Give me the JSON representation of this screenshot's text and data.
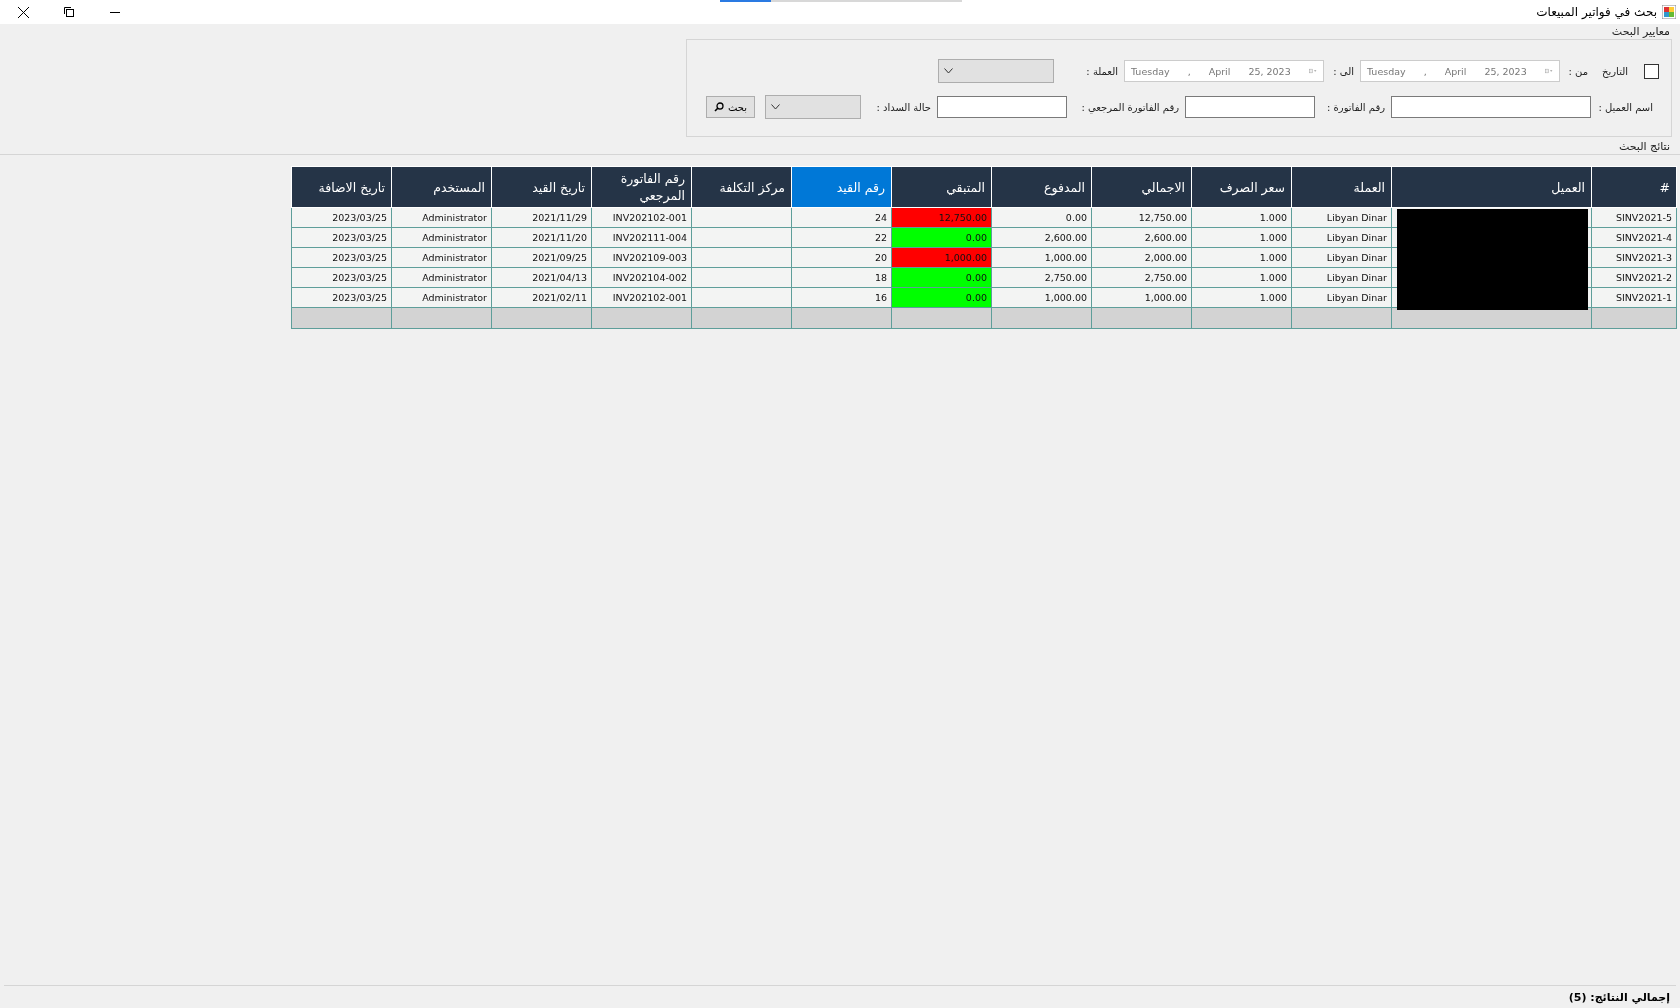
{
  "window": {
    "title": "بحث في فواتير المبيعات",
    "controls": [
      {
        "kind": "close"
      },
      {
        "kind": "restore"
      },
      {
        "kind": "minimize"
      }
    ]
  },
  "progress": {
    "level": 0.21
  },
  "criteria": {
    "legend": "معايير البحث",
    "date_filter": {
      "label": "التاريخ",
      "checked": false
    },
    "from": {
      "label": "من :",
      "weekday": "Tuesday",
      "sep": ",",
      "month": "April",
      "day": "25, 2023",
      "disabled": true
    },
    "to": {
      "label": "الى :",
      "weekday": "Tuesday",
      "sep": ",",
      "month": "April",
      "day": "25, 2023",
      "disabled": true
    },
    "currency": {
      "label": "العملة :"
    },
    "customer_name": {
      "label": "اسم العميل :"
    },
    "invoice_no": {
      "label": "رقم الفاتورة :"
    },
    "ref_invoice_no": {
      "label": "رقم الفاتورة المرجعي :"
    },
    "payment_status": {
      "label": "حالة السداد :"
    },
    "search_button": "بحث"
  },
  "results": {
    "legend": "نتائج البحث",
    "customer_redacted": true,
    "columns": [
      {
        "label": "#",
        "selected": false
      },
      {
        "label": "العميل",
        "selected": false
      },
      {
        "label": "العملة",
        "selected": false
      },
      {
        "label": "سعر الصرف",
        "selected": false
      },
      {
        "label": "الاجمالي",
        "selected": false
      },
      {
        "label": "المدفوع",
        "selected": false
      },
      {
        "label": "المتبقي",
        "selected": false
      },
      {
        "label": "رقم القيد",
        "selected": true
      },
      {
        "label": "مركز التكلفة",
        "selected": false
      },
      {
        "label": "رقم الفاتورة المرجعي",
        "selected": false
      },
      {
        "label": "تاريخ القيد",
        "selected": false
      },
      {
        "label": "المستخدم",
        "selected": false
      },
      {
        "label": "تاريخ الاضافة",
        "selected": false
      }
    ],
    "rows": [
      {
        "number": "SINV2021-5",
        "currency": "Libyan Dinar",
        "rate": "1.000",
        "total": "12,750.00",
        "paid": "0.00",
        "remaining": "12,750.00",
        "settled": false,
        "entry": "24",
        "ref": "INV202102-001",
        "entry_date": "2021/11/29",
        "user": "Administrator",
        "added": "2023/03/25"
      },
      {
        "number": "SINV2021-4",
        "currency": "Libyan Dinar",
        "rate": "1.000",
        "total": "2,600.00",
        "paid": "2,600.00",
        "remaining": "0.00",
        "settled": true,
        "entry": "22",
        "ref": "INV202111-004",
        "entry_date": "2021/11/20",
        "user": "Administrator",
        "added": "2023/03/25"
      },
      {
        "number": "SINV2021-3",
        "currency": "Libyan Dinar",
        "rate": "1.000",
        "total": "2,000.00",
        "paid": "1,000.00",
        "remaining": "1,000.00",
        "settled": false,
        "entry": "20",
        "ref": "INV202109-003",
        "entry_date": "2021/09/25",
        "user": "Administrator",
        "added": "2023/03/25"
      },
      {
        "number": "SINV2021-2",
        "currency": "Libyan Dinar",
        "rate": "1.000",
        "total": "2,750.00",
        "paid": "2,750.00",
        "remaining": "0.00",
        "settled": true,
        "entry": "18",
        "ref": "INV202104-002",
        "entry_date": "2021/04/13",
        "user": "Administrator",
        "added": "2023/03/25"
      },
      {
        "number": "SINV2021-1",
        "currency": "Libyan Dinar",
        "rate": "1.000",
        "total": "1,000.00",
        "paid": "1,000.00",
        "remaining": "0.00",
        "settled": true,
        "entry": "16",
        "ref": "INV202102-001",
        "entry_date": "2021/02/11",
        "user": "Administrator",
        "added": "2023/03/25"
      }
    ]
  },
  "status_bar": {
    "total": "إجمالي النتائج: (5)"
  }
}
